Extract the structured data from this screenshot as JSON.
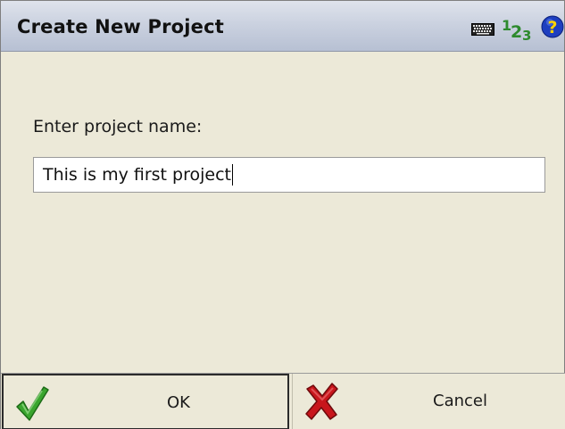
{
  "window": {
    "title": "Create New Project"
  },
  "titlebar_icons": {
    "keyboard": "keyboard-icon",
    "numeric_input": {
      "d1": "1",
      "d2": "2",
      "d3": "3"
    },
    "help": "help-icon"
  },
  "form": {
    "prompt": "Enter project name:",
    "project_name_value": "This is my first project"
  },
  "buttons": {
    "ok_label": "OK",
    "cancel_label": "Cancel"
  },
  "colors": {
    "background": "#ece9d8",
    "ok_check": "#3aa52e",
    "cancel_x": "#c8161c",
    "help_circle": "#1e3fbf",
    "numeric": "#2d8a2d"
  }
}
